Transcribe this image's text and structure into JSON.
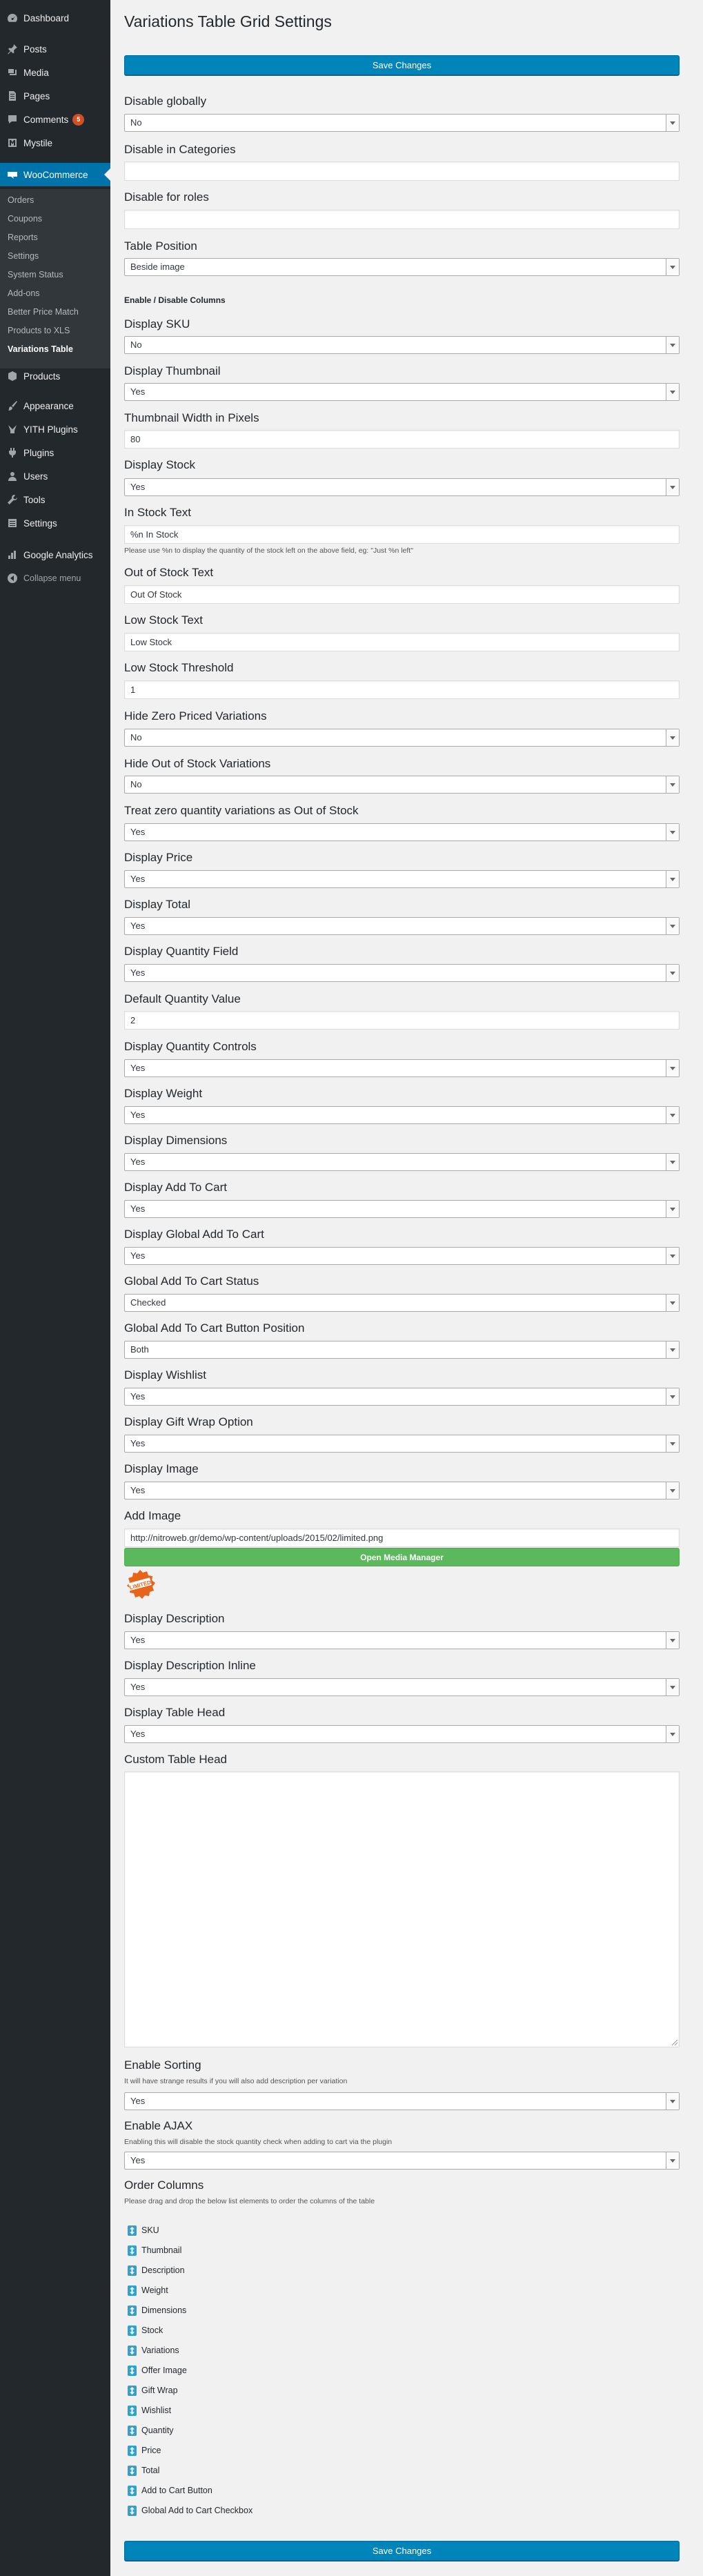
{
  "sidebar": {
    "dashboard": "Dashboard",
    "posts": "Posts",
    "media": "Media",
    "pages": "Pages",
    "comments": "Comments",
    "comments_count": "5",
    "mystile": "Mystile",
    "woocommerce": "WooCommerce",
    "submenu": [
      "Orders",
      "Coupons",
      "Reports",
      "Settings",
      "System Status",
      "Add-ons",
      "Better Price Match",
      "Products to XLS",
      "Variations Table"
    ],
    "products": "Products",
    "appearance": "Appearance",
    "yith": "YITH Plugins",
    "plugins": "Plugins",
    "users": "Users",
    "tools": "Tools",
    "settings": "Settings",
    "analytics": "Google Analytics",
    "collapse": "Collapse menu"
  },
  "page": {
    "title": "Variations Table Grid Settings",
    "save_label": "Save Changes"
  },
  "fields": {
    "disable_globally": {
      "label": "Disable globally",
      "value": "No"
    },
    "disable_categories": {
      "label": "Disable in Categories",
      "value": ""
    },
    "disable_roles": {
      "label": "Disable for roles",
      "value": ""
    },
    "table_position": {
      "label": "Table Position",
      "value": "Beside image"
    },
    "columns_heading": "Enable / Disable Columns",
    "display_sku": {
      "label": "Display SKU",
      "value": "No"
    },
    "display_thumbnail": {
      "label": "Display Thumbnail",
      "value": "Yes"
    },
    "thumb_width": {
      "label": "Thumbnail Width in Pixels",
      "value": "80"
    },
    "display_stock": {
      "label": "Display Stock",
      "value": "Yes"
    },
    "in_stock_text": {
      "label": "In Stock Text",
      "value": "%n In Stock",
      "desc": "Please use %n to display the quantity of the stock left on the above field, eg: \"Just %n left\""
    },
    "out_of_stock_text": {
      "label": "Out of Stock Text",
      "value": "Out Of Stock"
    },
    "low_stock_text": {
      "label": "Low Stock Text",
      "value": "Low Stock"
    },
    "low_stock_threshold": {
      "label": "Low Stock Threshold",
      "value": "1"
    },
    "hide_zero_priced": {
      "label": "Hide Zero Priced Variations",
      "value": "No"
    },
    "hide_out_of_stock": {
      "label": "Hide Out of Stock Variations",
      "value": "No"
    },
    "treat_zero_qty": {
      "label": "Treat zero quantity variations as Out of Stock",
      "value": "Yes"
    },
    "display_price": {
      "label": "Display Price",
      "value": "Yes"
    },
    "display_total": {
      "label": "Display Total",
      "value": "Yes"
    },
    "display_qty_field": {
      "label": "Display Quantity Field",
      "value": "Yes"
    },
    "default_qty": {
      "label": "Default Quantity Value",
      "value": "2"
    },
    "display_qty_controls": {
      "label": "Display Quantity Controls",
      "value": "Yes"
    },
    "display_weight": {
      "label": "Display Weight",
      "value": "Yes"
    },
    "display_dimensions": {
      "label": "Display Dimensions",
      "value": "Yes"
    },
    "display_add_to_cart": {
      "label": "Display Add To Cart",
      "value": "Yes"
    },
    "display_global_add": {
      "label": "Display Global Add To Cart",
      "value": "Yes"
    },
    "global_add_status": {
      "label": "Global Add To Cart Status",
      "value": "Checked"
    },
    "global_add_position": {
      "label": "Global Add To Cart Button Position",
      "value": "Both"
    },
    "display_wishlist": {
      "label": "Display Wishlist",
      "value": "Yes"
    },
    "display_gift_wrap": {
      "label": "Display Gift Wrap Option",
      "value": "Yes"
    },
    "display_image": {
      "label": "Display Image",
      "value": "Yes"
    },
    "add_image": {
      "label": "Add Image",
      "value": "http://nitroweb.gr/demo/wp-content/uploads/2015/02/limited.png",
      "button": "Open Media Manager"
    },
    "display_description": {
      "label": "Display Description",
      "value": "Yes"
    },
    "display_desc_inline": {
      "label": "Display Description Inline",
      "value": "Yes"
    },
    "display_table_head": {
      "label": "Display Table Head",
      "value": "Yes"
    },
    "custom_table_head": {
      "label": "Custom Table Head"
    },
    "enable_sorting": {
      "label": "Enable Sorting",
      "desc": "It will have strange results if you will also add description per variation",
      "value": "Yes"
    },
    "enable_ajax": {
      "label": "Enable AJAX",
      "desc": "Enabling this will disable the stock quantity check when adding to cart via the plugin",
      "value": "Yes"
    },
    "order_columns": {
      "label": "Order Columns",
      "desc": "Please drag and drop the below list elements to order the columns of the table"
    }
  },
  "order_items": [
    "SKU",
    "Thumbnail",
    "Description",
    "Weight",
    "Dimensions",
    "Stock",
    "Variations",
    "Offer Image",
    "Gift Wrap",
    "Wishlist",
    "Quantity",
    "Price",
    "Total",
    "Add to Cart Button",
    "Global Add to Cart Checkbox"
  ],
  "colors": {
    "sidebar": "#23282d",
    "active": "#0073aa",
    "primary_button": "#0085ba",
    "media_button": "#5cb85c",
    "badge": "#d54e21"
  }
}
